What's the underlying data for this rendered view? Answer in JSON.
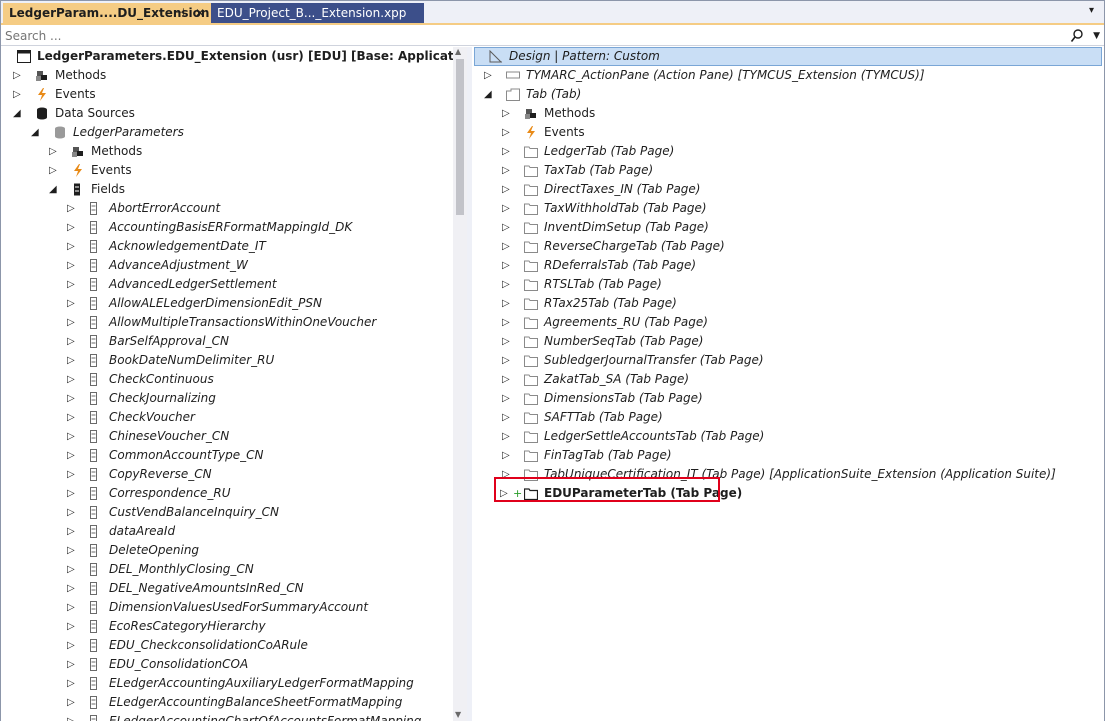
{
  "tabs": {
    "active": {
      "label": "LedgerParam....DU_Extension",
      "pin": "⊣",
      "close": "✕"
    },
    "inactive": {
      "label": "EDU_Project_B..._Extension.xpp"
    },
    "dropdown": "▾"
  },
  "search": {
    "placeholder": "Search ...",
    "value": ""
  },
  "left_tree": {
    "root": "LedgerParameters.EDU_Extension (usr) [EDU] [Base: Application Suite]",
    "methods": "Methods",
    "events": "Events",
    "data_sources": "Data Sources",
    "ds_name": "LedgerParameters",
    "ds_methods": "Methods",
    "ds_events": "Events",
    "fields_label": "Fields",
    "fields": [
      "AbortErrorAccount",
      "AccountingBasisERFormatMappingId_DK",
      "AcknowledgementDate_IT",
      "AdvanceAdjustment_W",
      "AdvancedLedgerSettlement",
      "AllowALELedgerDimensionEdit_PSN",
      "AllowMultipleTransactionsWithinOneVoucher",
      "BarSelfApproval_CN",
      "BookDateNumDelimiter_RU",
      "CheckContinuous",
      "CheckJournalizing",
      "CheckVoucher",
      "ChineseVoucher_CN",
      "CommonAccountType_CN",
      "CopyReverse_CN",
      "Correspondence_RU",
      "CustVendBalanceInquiry_CN",
      "dataAreaId",
      "DeleteOpening",
      "DEL_MonthlyClosing_CN",
      "DEL_NegativeAmountsInRed_CN",
      "DimensionValuesUsedForSummaryAccount",
      "EcoResCategoryHierarchy",
      "EDU_CheckconsolidationCoARule",
      "EDU_ConsolidationCOA",
      "ELedgerAccountingAuxiliaryLedgerFormatMapping",
      "ELedgerAccountingBalanceSheetFormatMapping",
      "ELedgerAccountingChartOfAccountsFormatMapping"
    ]
  },
  "right_tree": {
    "header": "Design | Pattern: Custom",
    "action_pane": "TYMARC_ActionPane (Action Pane) [TYMCUS_Extension (TYMCUS)]",
    "tab": "Tab (Tab)",
    "methods": "Methods",
    "events": "Events",
    "tab_pages": [
      "LedgerTab (Tab Page)",
      "TaxTab (Tab Page)",
      "DirectTaxes_IN (Tab Page)",
      "TaxWithholdTab (Tab Page)",
      "InventDimSetup (Tab Page)",
      "ReverseChargeTab (Tab Page)",
      "RDeferralsTab (Tab Page)",
      "RTSLTab (Tab Page)",
      "RTax25Tab (Tab Page)",
      "Agreements_RU (Tab Page)",
      "NumberSeqTab (Tab Page)",
      "SubledgerJournalTransfer (Tab Page)",
      "ZakatTab_SA (Tab Page)",
      "DimensionsTab (Tab Page)",
      "SAFTTab (Tab Page)",
      "LedgerSettleAccountsTab (Tab Page)",
      "FinTagTab (Tab Page)",
      "TabUniqueCertification_IT (Tab Page) [ApplicationSuite_Extension (Application Suite)]"
    ],
    "new_tab_page": "EDUParameterTab (Tab Page)",
    "new_marker": "+"
  }
}
